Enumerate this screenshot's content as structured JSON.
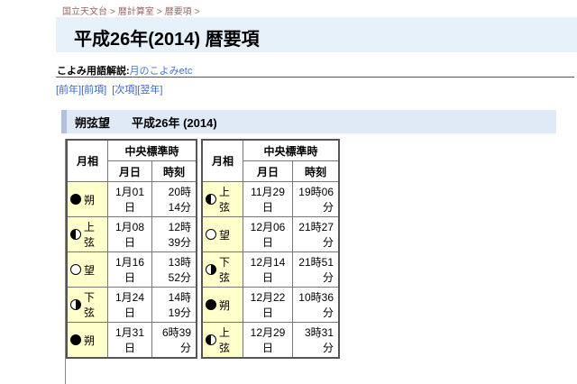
{
  "breadcrumb": {
    "separator": ">",
    "items": [
      {
        "label": "国立天文台"
      },
      {
        "label": "暦計算室"
      },
      {
        "label": "暦要項"
      }
    ]
  },
  "header": {
    "title": "平成26年(2014) 暦要項"
  },
  "glossary": {
    "label": "こよみ用語解説:",
    "link_label": "月のこよみetc"
  },
  "nav": {
    "prev_year": "[前年]",
    "prev_item": "[前項]",
    "next_item": "[次項]",
    "next_year": "[翌年]"
  },
  "section": {
    "title": "朔弦望",
    "year": "平成26年 (2014)"
  },
  "table_headers": {
    "phase": "月相",
    "time_group": "中央標準時",
    "date": "月日",
    "time": "時刻"
  },
  "tables": [
    {
      "rows": [
        {
          "phase": "new",
          "phase_label": "朔",
          "date": "1月01日",
          "time": "20時14分"
        },
        {
          "phase": "first",
          "phase_label": "上弦",
          "date": "1月08日",
          "time": "12時39分"
        },
        {
          "phase": "full",
          "phase_label": "望",
          "date": "1月16日",
          "time": "13時52分"
        },
        {
          "phase": "last",
          "phase_label": "下弦",
          "date": "1月24日",
          "time": "14時19分"
        },
        {
          "phase": "new",
          "phase_label": "朔",
          "date": "1月31日",
          "time": "6時39分"
        }
      ]
    },
    {
      "rows": [
        {
          "phase": "first",
          "phase_label": "上弦",
          "date": "11月29日",
          "time": "19時06分"
        },
        {
          "phase": "full",
          "phase_label": "望",
          "date": "12月06日",
          "time": "21時27分"
        },
        {
          "phase": "last",
          "phase_label": "下弦",
          "date": "12月14日",
          "time": "21時51分"
        },
        {
          "phase": "new",
          "phase_label": "朔",
          "date": "12月22日",
          "time": "10時36分"
        },
        {
          "phase": "first",
          "phase_label": "上弦",
          "date": "12月29日",
          "time": "3時31分"
        }
      ]
    }
  ],
  "colors": {
    "title_bar_bg": "#e7f1fa",
    "section_bar_bg": "#dfeaf6",
    "section_accent": "#b2c0de",
    "phase_cell_yellow": "#ffffcc",
    "link_blue": "#3366cc",
    "breadcrumb_brown": "#996666"
  }
}
